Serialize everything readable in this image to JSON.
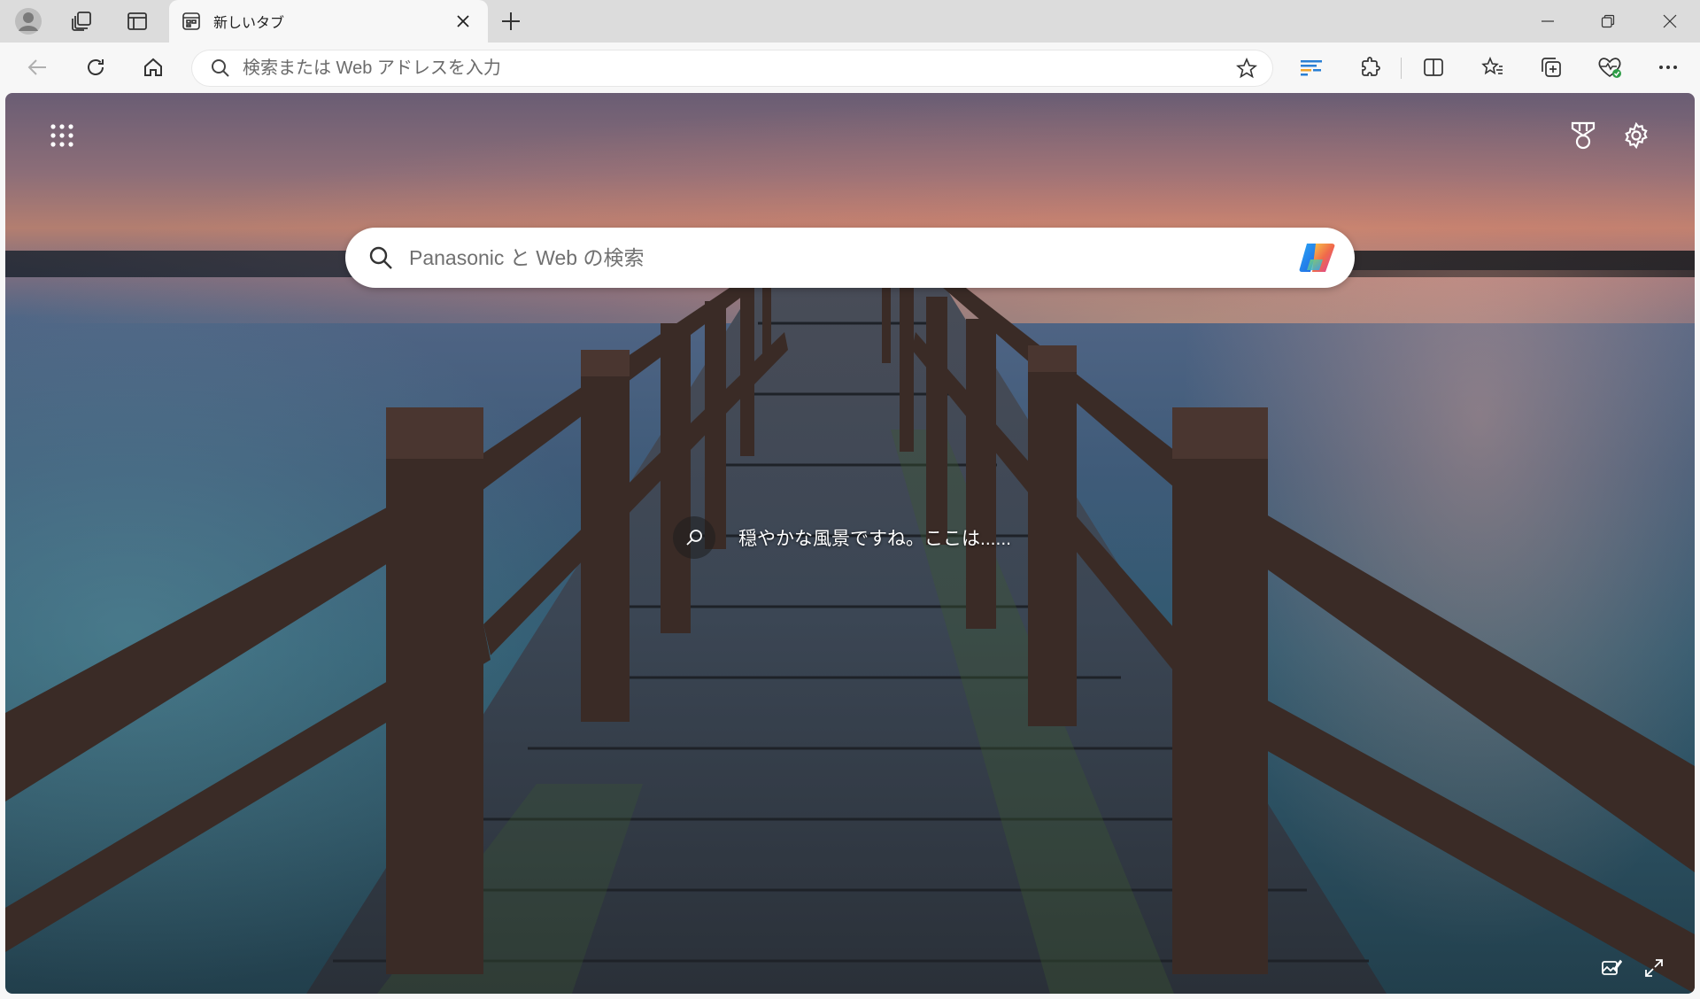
{
  "tab": {
    "title": "新しいタブ"
  },
  "addressbar": {
    "placeholder": "検索または Web アドレスを入力"
  },
  "newtab": {
    "search_placeholder": "Panasonic と Web の検索",
    "image_caption": "穏やかな風景ですね。ここは......"
  },
  "icons": {
    "profile": "profile-avatar-icon",
    "workspaces": "workspaces-icon",
    "tab_actions": "tab-actions-icon",
    "tab_favicon": "newtab-favicon-icon",
    "close_tab": "close-icon",
    "new_tab": "plus-icon",
    "back": "arrow-left-icon",
    "refresh": "refresh-icon",
    "home": "home-icon",
    "search": "search-icon",
    "favorite": "star-icon",
    "reading": "read-aloud-icon",
    "extensions": "puzzle-icon",
    "split_screen": "split-screen-icon",
    "favorites": "favorites-icon",
    "collections": "collections-icon",
    "browser_essentials": "heart-pulse-icon",
    "more": "ellipsis-icon",
    "apps": "app-launcher-icon",
    "rewards": "trophy-icon",
    "settings": "gear-icon",
    "copilot": "copilot-icon",
    "customize": "edit-background-icon",
    "fullscreen": "expand-icon"
  },
  "colors": {
    "titlebar_bg": "#dcdcdc",
    "toolbar_bg": "#f7f7f7",
    "searchbox_bg": "#ffffff"
  }
}
